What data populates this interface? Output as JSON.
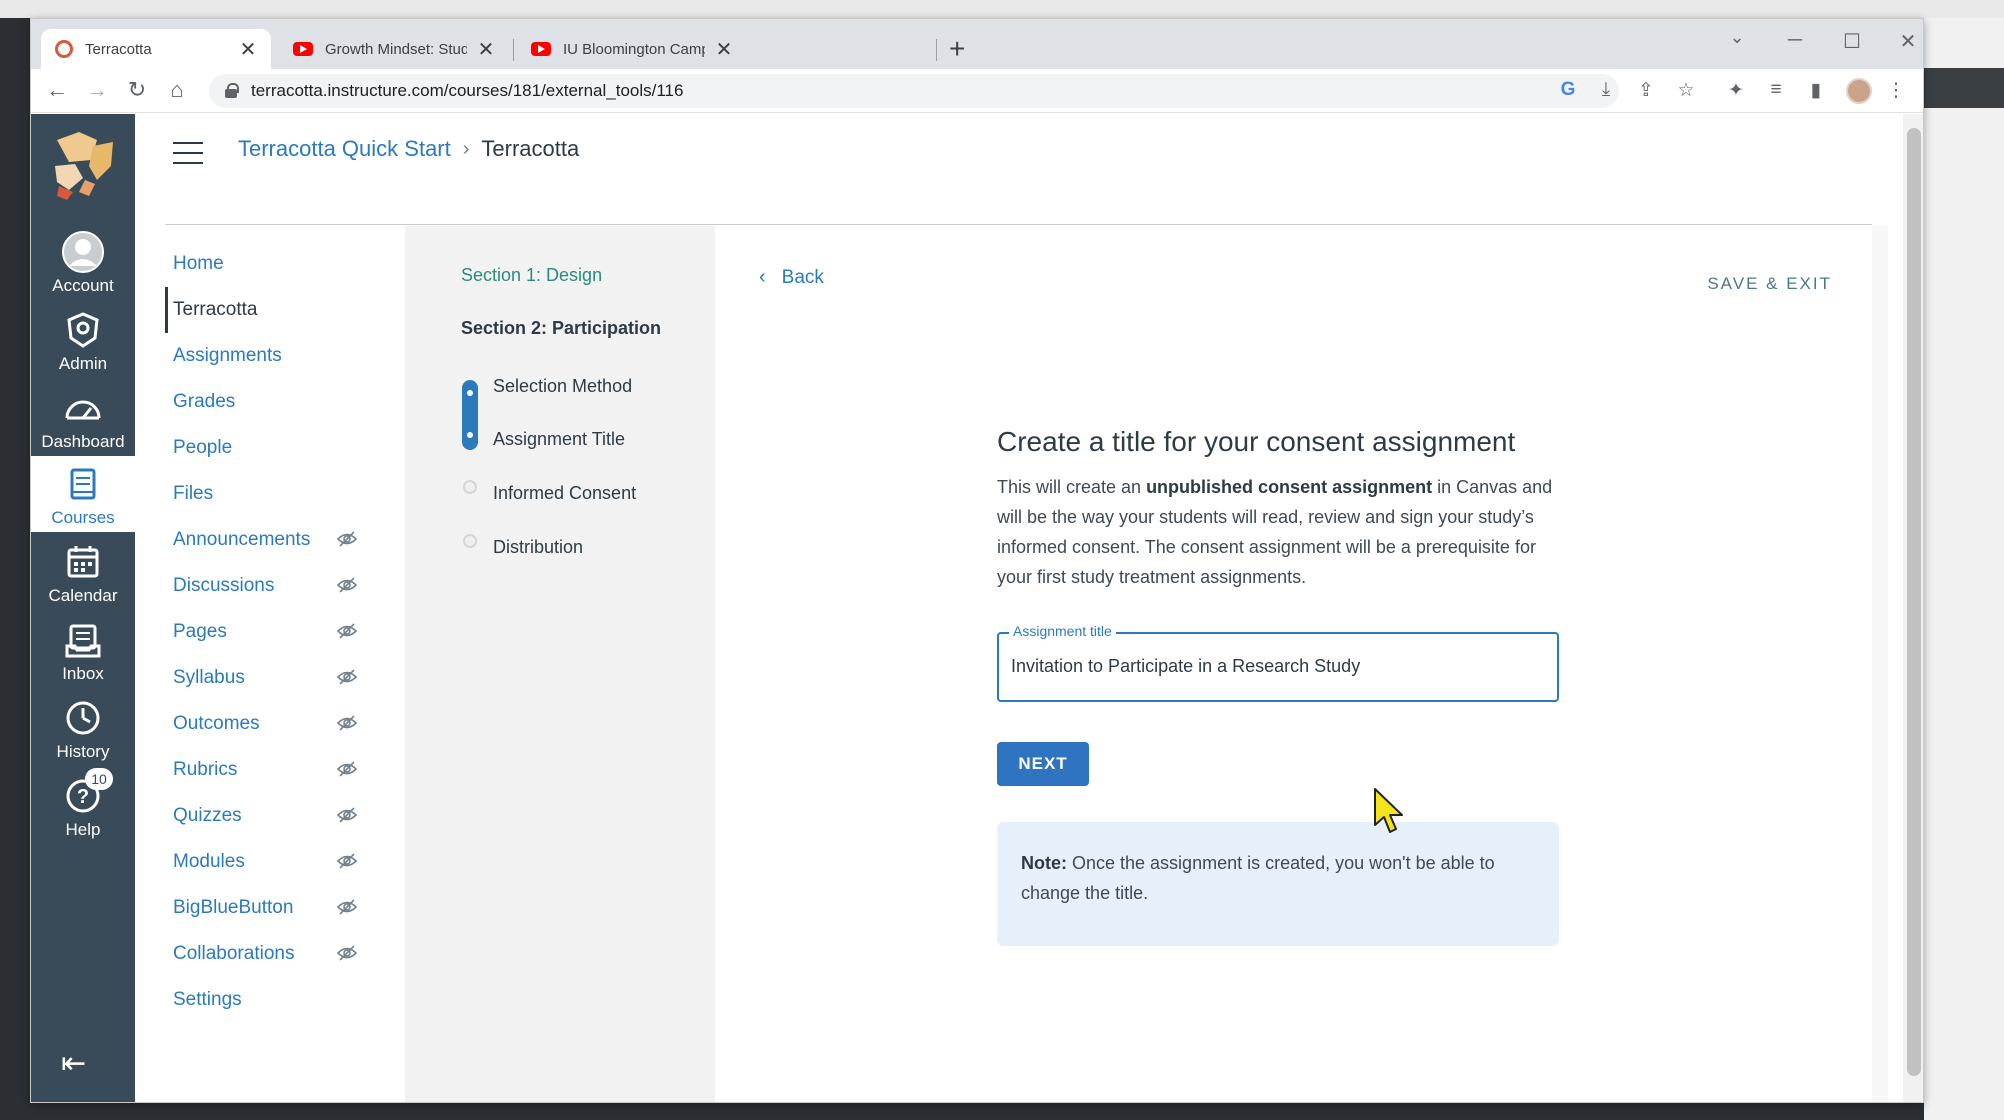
{
  "browser": {
    "tabs": [
      {
        "title": "Terracotta",
        "close": "✕"
      },
      {
        "title": "Growth Mindset: Studies showing",
        "close": "✕"
      },
      {
        "title": "IU Bloomington Campus Tour - Y",
        "close": "✕"
      }
    ],
    "url": "terracotta.instructure.com/courses/181/external_tools/116",
    "icons": {
      "back": "←",
      "forward": "→",
      "reload": "↻",
      "home": "⌂",
      "newtab": "+",
      "minimize": "─",
      "maximize": "☐",
      "close": "✕",
      "menu": "⋮",
      "google": "G",
      "install": "⤓",
      "share": "⇪",
      "star": "☆",
      "extensions": "✦",
      "media": "≡",
      "sidepanel": "▮"
    }
  },
  "global_nav": {
    "items": [
      {
        "label": "Account",
        "icon": "account-icon"
      },
      {
        "label": "Admin",
        "icon": "admin-icon"
      },
      {
        "label": "Dashboard",
        "icon": "dashboard-icon"
      },
      {
        "label": "Courses",
        "icon": "courses-icon"
      },
      {
        "label": "Calendar",
        "icon": "calendar-icon"
      },
      {
        "label": "Inbox",
        "icon": "inbox-icon"
      },
      {
        "label": "History",
        "icon": "history-icon"
      },
      {
        "label": "Help",
        "icon": "help-icon",
        "badge": "10"
      }
    ],
    "collapse": "⇤"
  },
  "breadcrumb": {
    "course": "Terracotta Quick Start",
    "sep": "›",
    "current": "Terracotta"
  },
  "course_nav": [
    {
      "label": "Home",
      "hidden": false
    },
    {
      "label": "Terracotta",
      "hidden": false
    },
    {
      "label": "Assignments",
      "hidden": false
    },
    {
      "label": "Grades",
      "hidden": false
    },
    {
      "label": "People",
      "hidden": false
    },
    {
      "label": "Files",
      "hidden": false
    },
    {
      "label": "Announcements",
      "hidden": true
    },
    {
      "label": "Discussions",
      "hidden": true
    },
    {
      "label": "Pages",
      "hidden": true
    },
    {
      "label": "Syllabus",
      "hidden": true
    },
    {
      "label": "Outcomes",
      "hidden": true
    },
    {
      "label": "Rubrics",
      "hidden": true
    },
    {
      "label": "Quizzes",
      "hidden": true
    },
    {
      "label": "Modules",
      "hidden": true
    },
    {
      "label": "BigBlueButton",
      "hidden": true
    },
    {
      "label": "Collaborations",
      "hidden": true
    },
    {
      "label": "Settings",
      "hidden": false
    }
  ],
  "steps": {
    "section1": "Section 1: Design",
    "section2": "Section 2: Participation",
    "items": [
      "Selection Method",
      "Assignment Title",
      "Informed Consent",
      "Distribution"
    ]
  },
  "main": {
    "back": "Back",
    "save_exit": "SAVE & EXIT",
    "heading": "Create a title for your consent assignment",
    "desc_pre": "This will create an ",
    "desc_bold": "unpublished consent assignment",
    "desc_post": " in Canvas and will be the way your students will read, review and sign your study’s informed consent. The consent assignment will be a prerequisite for your first study treatment assignments.",
    "field_label": "Assignment title",
    "field_value": "Invitation to Participate in a Research Study",
    "next": "NEXT",
    "note_bold": "Note:",
    "note_text": " Once the assignment is created, you won't be able to change the title."
  },
  "colors": {
    "nav": "#394b58",
    "link": "#2b7abc",
    "primary": "#2f74c1",
    "note_bg": "#e6f0fa"
  }
}
